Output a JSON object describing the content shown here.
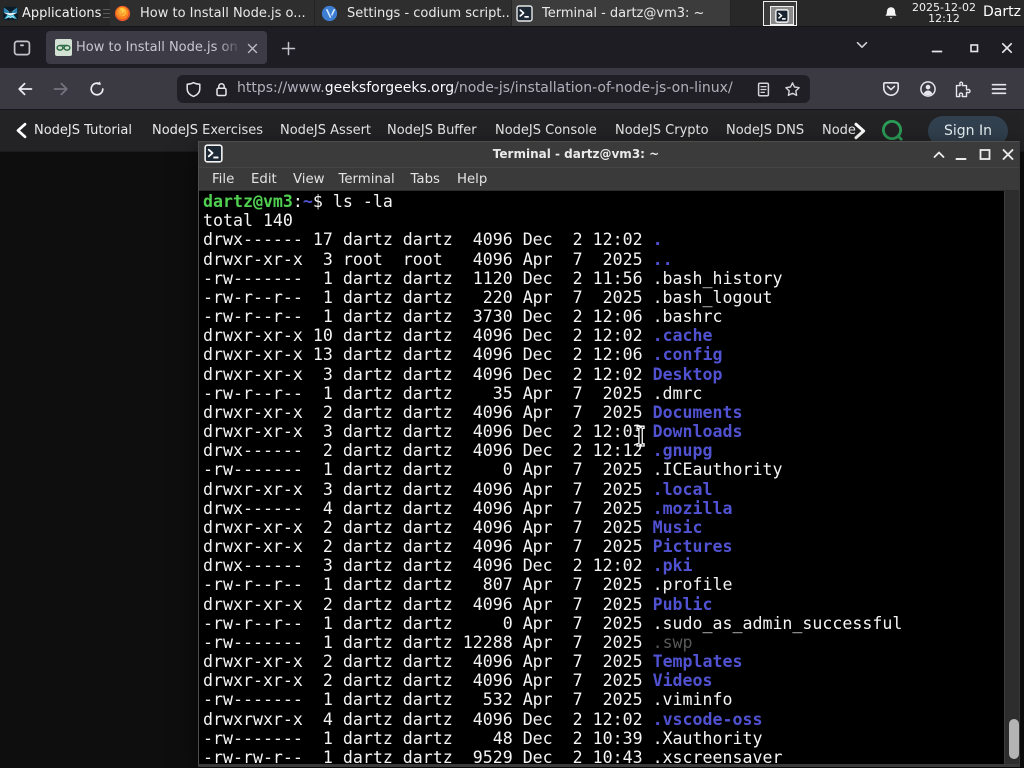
{
  "panel": {
    "applications_label": "Applications",
    "taskbar": [
      {
        "icon": "firefox",
        "label": "How to Install Node.js o..."
      },
      {
        "icon": "vscodium",
        "label": "Settings - codium script..."
      },
      {
        "icon": "terminal",
        "label": "Terminal - dartz@vm3: ~",
        "active": true
      }
    ],
    "clock_date": "2025-12-02",
    "clock_time": "12:12",
    "user_label": "Dartz"
  },
  "browser": {
    "tab_title": "How to Install Node.js on",
    "url_scheme": "https://www.",
    "url_domain": "geeksforgeeks.org",
    "url_path": "/node-js/installation-of-node-js-on-linux/"
  },
  "gfg": {
    "items": [
      "NodeJS Tutorial",
      "NodeJS Exercises",
      "NodeJS Assert",
      "NodeJS Buffer",
      "NodeJS Console",
      "NodeJS Crypto",
      "NodeJS DNS",
      "Node"
    ],
    "signin_label": "Sign In"
  },
  "terminal": {
    "title": "Terminal - dartz@vm3: ~",
    "menu": [
      "File",
      "Edit",
      "View",
      "Terminal",
      "Tabs",
      "Help"
    ],
    "lines": [
      [
        [
          "dartz@vm3",
          "g"
        ],
        [
          ":",
          "w"
        ],
        [
          "~",
          "b"
        ],
        [
          "$ ls -la",
          "w"
        ]
      ],
      [
        [
          "total 140",
          "w"
        ]
      ],
      [
        [
          "drwx------ 17 dartz dartz  4096 Dec  2 12:02 ",
          "w"
        ],
        [
          ".",
          "b"
        ]
      ],
      [
        [
          "drwxr-xr-x  3 root  root   4096 Apr  7  2025 ",
          "w"
        ],
        [
          "..",
          "b"
        ]
      ],
      [
        [
          "-rw-------  1 dartz dartz  1120 Dec  2 11:56 .bash_history",
          "w"
        ]
      ],
      [
        [
          "-rw-r--r--  1 dartz dartz   220 Apr  7  2025 .bash_logout",
          "w"
        ]
      ],
      [
        [
          "-rw-r--r--  1 dartz dartz  3730 Dec  2 12:06 .bashrc",
          "w"
        ]
      ],
      [
        [
          "drwxr-xr-x 10 dartz dartz  4096 Dec  2 12:02 ",
          "w"
        ],
        [
          ".cache",
          "b"
        ]
      ],
      [
        [
          "drwxr-xr-x 13 dartz dartz  4096 Dec  2 12:06 ",
          "w"
        ],
        [
          ".config",
          "b"
        ]
      ],
      [
        [
          "drwxr-xr-x  3 dartz dartz  4096 Dec  2 12:02 ",
          "w"
        ],
        [
          "Desktop",
          "b"
        ]
      ],
      [
        [
          "-rw-r--r--  1 dartz dartz    35 Apr  7  2025 .dmrc",
          "w"
        ]
      ],
      [
        [
          "drwxr-xr-x  2 dartz dartz  4096 Apr  7  2025 ",
          "w"
        ],
        [
          "Documents",
          "b"
        ]
      ],
      [
        [
          "drwxr-xr-x  3 dartz dartz  4096 Dec  2 12:03 ",
          "w"
        ],
        [
          "Downloads",
          "b"
        ]
      ],
      [
        [
          "drwx------  2 dartz dartz  4096 Dec  2 12:12 ",
          "w"
        ],
        [
          ".gnupg",
          "b"
        ]
      ],
      [
        [
          "-rw-------  1 dartz dartz     0 Apr  7  2025 .ICEauthority",
          "w"
        ]
      ],
      [
        [
          "drwxr-xr-x  3 dartz dartz  4096 Apr  7  2025 ",
          "w"
        ],
        [
          ".local",
          "b"
        ]
      ],
      [
        [
          "drwx------  4 dartz dartz  4096 Apr  7  2025 ",
          "w"
        ],
        [
          ".mozilla",
          "b"
        ]
      ],
      [
        [
          "drwxr-xr-x  2 dartz dartz  4096 Apr  7  2025 ",
          "w"
        ],
        [
          "Music",
          "b"
        ]
      ],
      [
        [
          "drwxr-xr-x  2 dartz dartz  4096 Apr  7  2025 ",
          "w"
        ],
        [
          "Pictures",
          "b"
        ]
      ],
      [
        [
          "drwx------  3 dartz dartz  4096 Dec  2 12:02 ",
          "w"
        ],
        [
          ".pki",
          "b"
        ]
      ],
      [
        [
          "-rw-r--r--  1 dartz dartz   807 Apr  7  2025 .profile",
          "w"
        ]
      ],
      [
        [
          "drwxr-xr-x  2 dartz dartz  4096 Apr  7  2025 ",
          "w"
        ],
        [
          "Public",
          "b"
        ]
      ],
      [
        [
          "-rw-r--r--  1 dartz dartz     0 Apr  7  2025 .sudo_as_admin_successful",
          "w"
        ]
      ],
      [
        [
          "-rw-------  1 dartz dartz 12288 Apr  7  2025 ",
          "w"
        ],
        [
          ".swp",
          "dim"
        ]
      ],
      [
        [
          "drwxr-xr-x  2 dartz dartz  4096 Apr  7  2025 ",
          "w"
        ],
        [
          "Templates",
          "b"
        ]
      ],
      [
        [
          "drwxr-xr-x  2 dartz dartz  4096 Apr  7  2025 ",
          "w"
        ],
        [
          "Videos",
          "b"
        ]
      ],
      [
        [
          "-rw-------  1 dartz dartz   532 Apr  7  2025 .viminfo",
          "w"
        ]
      ],
      [
        [
          "drwxrwxr-x  4 dartz dartz  4096 Dec  2 12:02 ",
          "w"
        ],
        [
          ".vscode-oss",
          "b"
        ]
      ],
      [
        [
          "-rw-------  1 dartz dartz    48 Dec  2 10:39 .Xauthority",
          "w"
        ]
      ],
      [
        [
          "-rw-rw-r--  1 dartz dartz  9529 Dec  2 10:43 .xscreensaver",
          "w"
        ]
      ]
    ]
  }
}
